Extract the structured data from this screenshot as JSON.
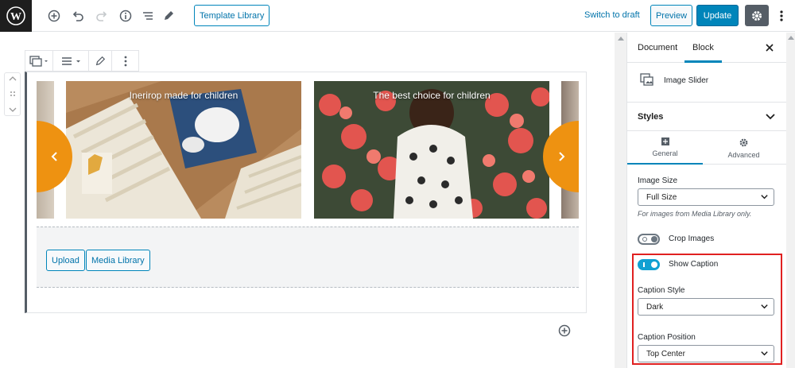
{
  "topbar": {
    "template_library": "Template Library",
    "switch_to_draft": "Switch to draft",
    "preview": "Preview",
    "update": "Update"
  },
  "slider": {
    "slides": [
      {
        "caption": "Inerirор made for children"
      },
      {
        "caption": "The best choice for children"
      }
    ],
    "accent_color": "#ee9211"
  },
  "upload": {
    "upload_label": "Upload",
    "media_library_label": "Media Library"
  },
  "sidebar": {
    "tabs": {
      "document": "Document",
      "block": "Block"
    },
    "block_name": "Image Slider",
    "styles_label": "Styles",
    "panel_tabs": {
      "general": "General",
      "advanced": "Advanced"
    },
    "image_size": {
      "label": "Image Size",
      "value": "Full Size",
      "help": "For images from Media Library only."
    },
    "crop_images": {
      "label": "Crop Images",
      "enabled": false
    },
    "show_caption": {
      "label": "Show Caption",
      "enabled": true
    },
    "caption_style": {
      "label": "Caption Style",
      "value": "Dark"
    },
    "caption_position": {
      "label": "Caption Position",
      "value": "Top Center"
    }
  },
  "colors": {
    "primary": "#0085ba",
    "highlight": "#e02020"
  }
}
